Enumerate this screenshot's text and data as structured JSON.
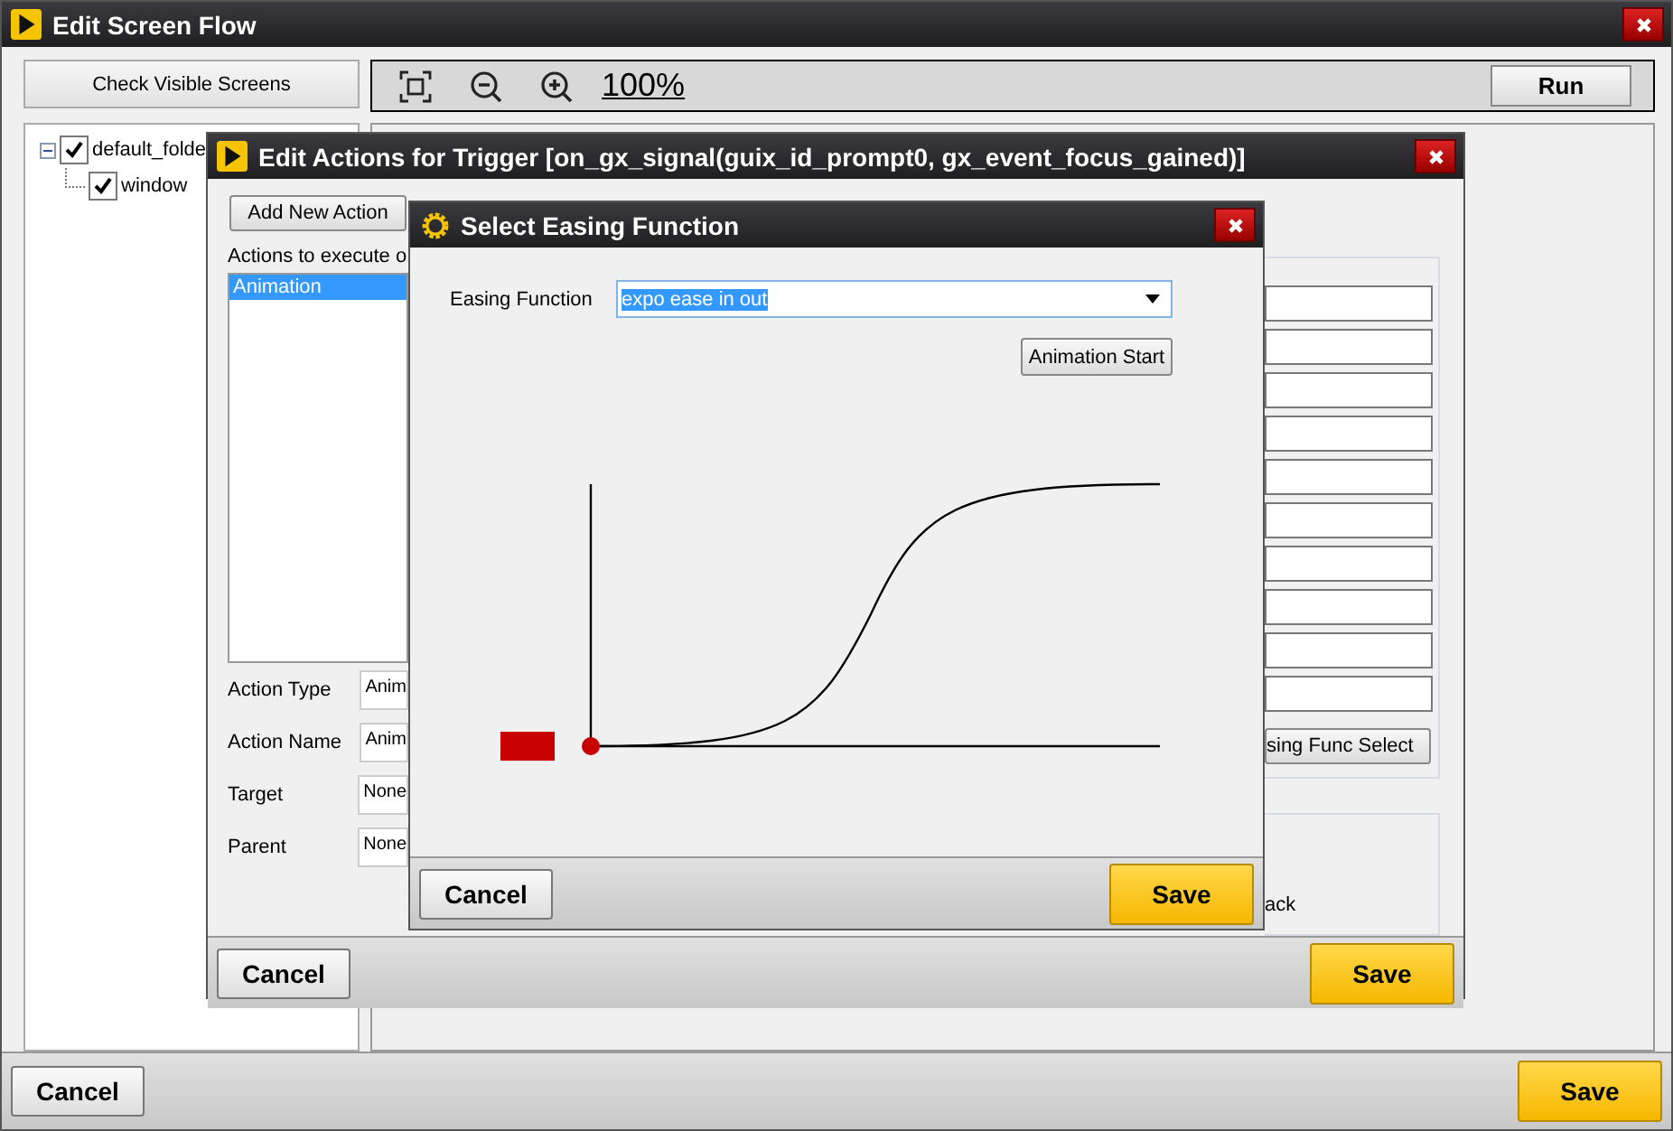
{
  "main_window": {
    "title": "Edit Screen Flow",
    "check_button": "Check Visible Screens",
    "zoom": "100%",
    "run_button": "Run",
    "tree": [
      {
        "label": "default_folde",
        "checked": true,
        "expanded": true,
        "children": [
          {
            "label": "window",
            "checked": true
          }
        ]
      }
    ],
    "cancel_button": "Cancel",
    "save_button": "Save"
  },
  "actions_dialog": {
    "title": "Edit Actions for Trigger [on_gx_signal(guix_id_prompt0, gx_event_focus_gained)]",
    "add_button": "Add New Action",
    "list_label": "Actions to execute o",
    "actions": [
      {
        "label": "Animation",
        "selected": true
      }
    ],
    "fields": [
      {
        "label": "Action Type",
        "value": "Anim"
      },
      {
        "label": "Action Name",
        "value": "Anim"
      },
      {
        "label": "Target",
        "value": "None"
      },
      {
        "label": "Parent",
        "value": "None"
      }
    ],
    "easing_button": "sing Func Select",
    "group_text": "ack",
    "cancel_button": "Cancel",
    "save_button": "Save"
  },
  "easing_dialog": {
    "title": "Select Easing Function",
    "field_label": "Easing Function",
    "value": "expo ease in out",
    "start_button": "Animation Start",
    "cancel_button": "Cancel",
    "save_button": "Save"
  }
}
